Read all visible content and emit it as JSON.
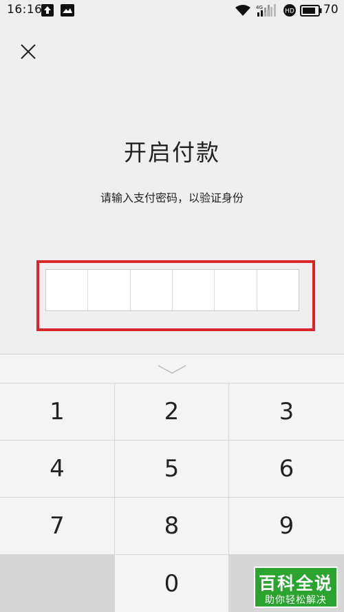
{
  "status_bar": {
    "time": "16:16",
    "battery": "70",
    "network": "4G",
    "hd_badge": "HD",
    "icons": [
      "upload-icon",
      "image-icon",
      "wifi-icon",
      "signal-icon",
      "signal-icon",
      "hd-icon",
      "battery-icon"
    ]
  },
  "header": {
    "close_icon": "close-icon"
  },
  "main": {
    "title": "开启付款",
    "subtitle": "请输入支付密码，以验证身份"
  },
  "pin": {
    "length": 6
  },
  "keypad": {
    "collapse_icon": "chevron-down-icon",
    "keys": [
      "1",
      "2",
      "3",
      "4",
      "5",
      "6",
      "7",
      "8",
      "9",
      "",
      "0",
      ""
    ]
  },
  "watermark": {
    "main": "百科全说",
    "sub": "助你轻松解决"
  },
  "colors": {
    "highlight": "#d8262b",
    "watermark": "#2aa32f",
    "background": "#efefef"
  }
}
